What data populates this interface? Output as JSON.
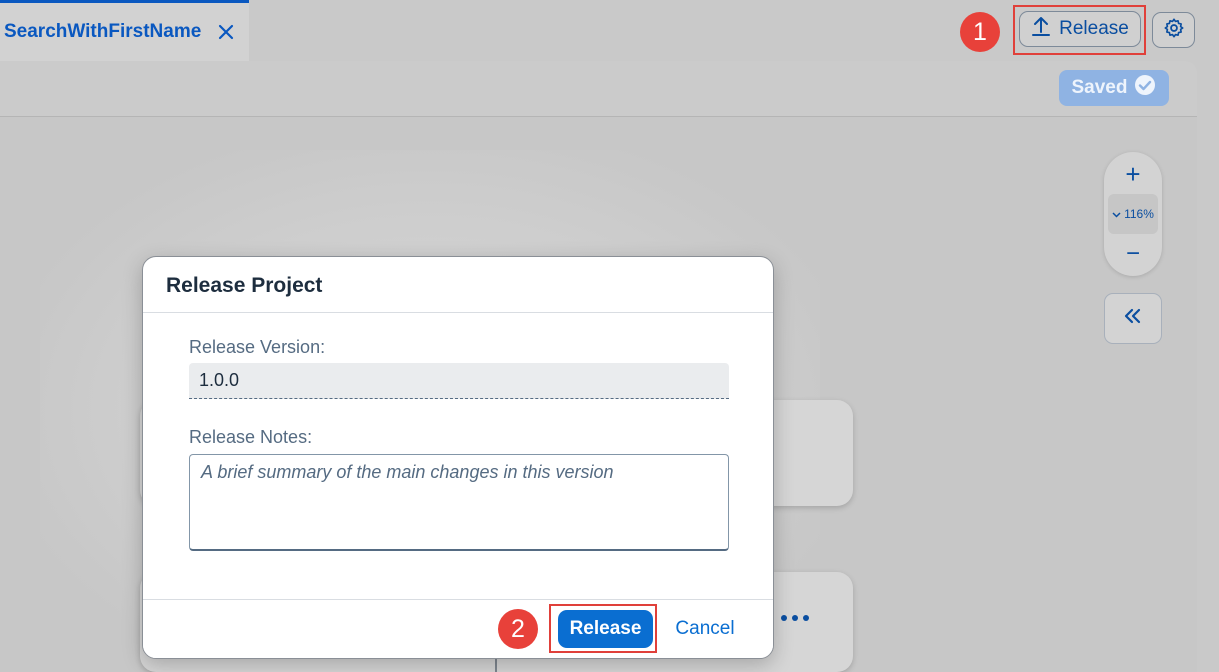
{
  "tab": {
    "label": "SearchWithFirstName"
  },
  "header": {
    "release_label": "Release"
  },
  "toolbar": {
    "saved_label": "Saved"
  },
  "zoom": {
    "plus": "+",
    "level": "116%",
    "minus": "−"
  },
  "callouts": {
    "one": "1",
    "two": "2"
  },
  "dialog": {
    "title": "Release Project",
    "version_label": "Release Version:",
    "version_value": "1.0.0",
    "notes_label": "Release Notes:",
    "notes_placeholder": "A brief summary of the main changes in this version",
    "release_button": "Release",
    "cancel_button": "Cancel"
  },
  "colors": {
    "accent": "#0a6ed1",
    "callout": "#e8413a"
  },
  "icons": [
    "close-icon",
    "upload-icon",
    "gear-icon",
    "check-circle-icon",
    "chevron-down-icon",
    "double-chevron-left-icon",
    "more-icon"
  ]
}
